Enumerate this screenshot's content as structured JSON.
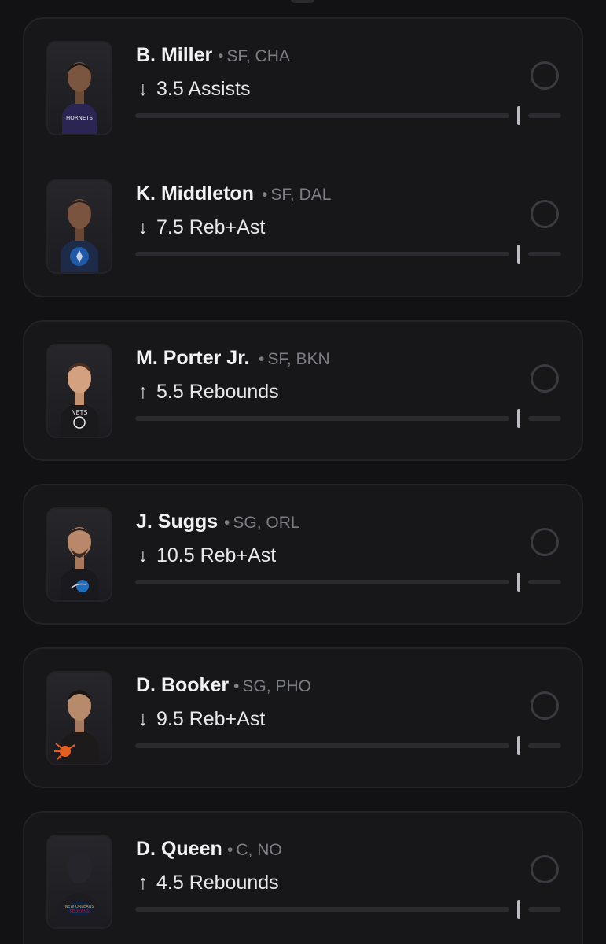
{
  "colors": {
    "background": "#121214",
    "card": "#17171a",
    "text_primary": "#f2f2f4",
    "text_secondary": "#7d7d84",
    "slider_track": "#2a2a2f"
  },
  "cards": [
    {
      "players": [
        {
          "name": "B. Miller",
          "dot": "•",
          "position_team": "SF, CHA",
          "arrow": "↓",
          "direction_icon": "arrow-down-icon",
          "line": "3.5 Assists",
          "jersey_color": "#2b2553"
        },
        {
          "name": "K. Middleton",
          "dot": "•",
          "position_team": "SF, DAL",
          "arrow": "↓",
          "direction_icon": "arrow-down-icon",
          "line": "7.5 Reb+Ast",
          "jersey_color": "#1d2a48"
        }
      ]
    },
    {
      "players": [
        {
          "name": "M. Porter Jr.",
          "dot": "•",
          "position_team": "SF, BKN",
          "arrow": "↑",
          "direction_icon": "arrow-up-icon",
          "line": "5.5 Rebounds",
          "jersey_color": "#1a1a1c"
        }
      ]
    },
    {
      "players": [
        {
          "name": "J. Suggs",
          "dot": "•",
          "position_team": "SG, ORL",
          "arrow": "↓",
          "direction_icon": "arrow-down-icon",
          "line": "10.5 Reb+Ast",
          "jersey_color": "#1a1a1e"
        }
      ]
    },
    {
      "players": [
        {
          "name": "D. Booker",
          "dot": "•",
          "position_team": "SG, PHO",
          "arrow": "↓",
          "direction_icon": "arrow-down-icon",
          "line": "9.5 Reb+Ast",
          "jersey_color": "#1d1a1c"
        }
      ]
    },
    {
      "players": [
        {
          "name": "D. Queen",
          "dot": "•",
          "position_team": "C, NO",
          "arrow": "↑",
          "direction_icon": "arrow-up-icon",
          "line": "4.5 Rebounds",
          "jersey_color": "#1c1c22"
        }
      ]
    }
  ]
}
